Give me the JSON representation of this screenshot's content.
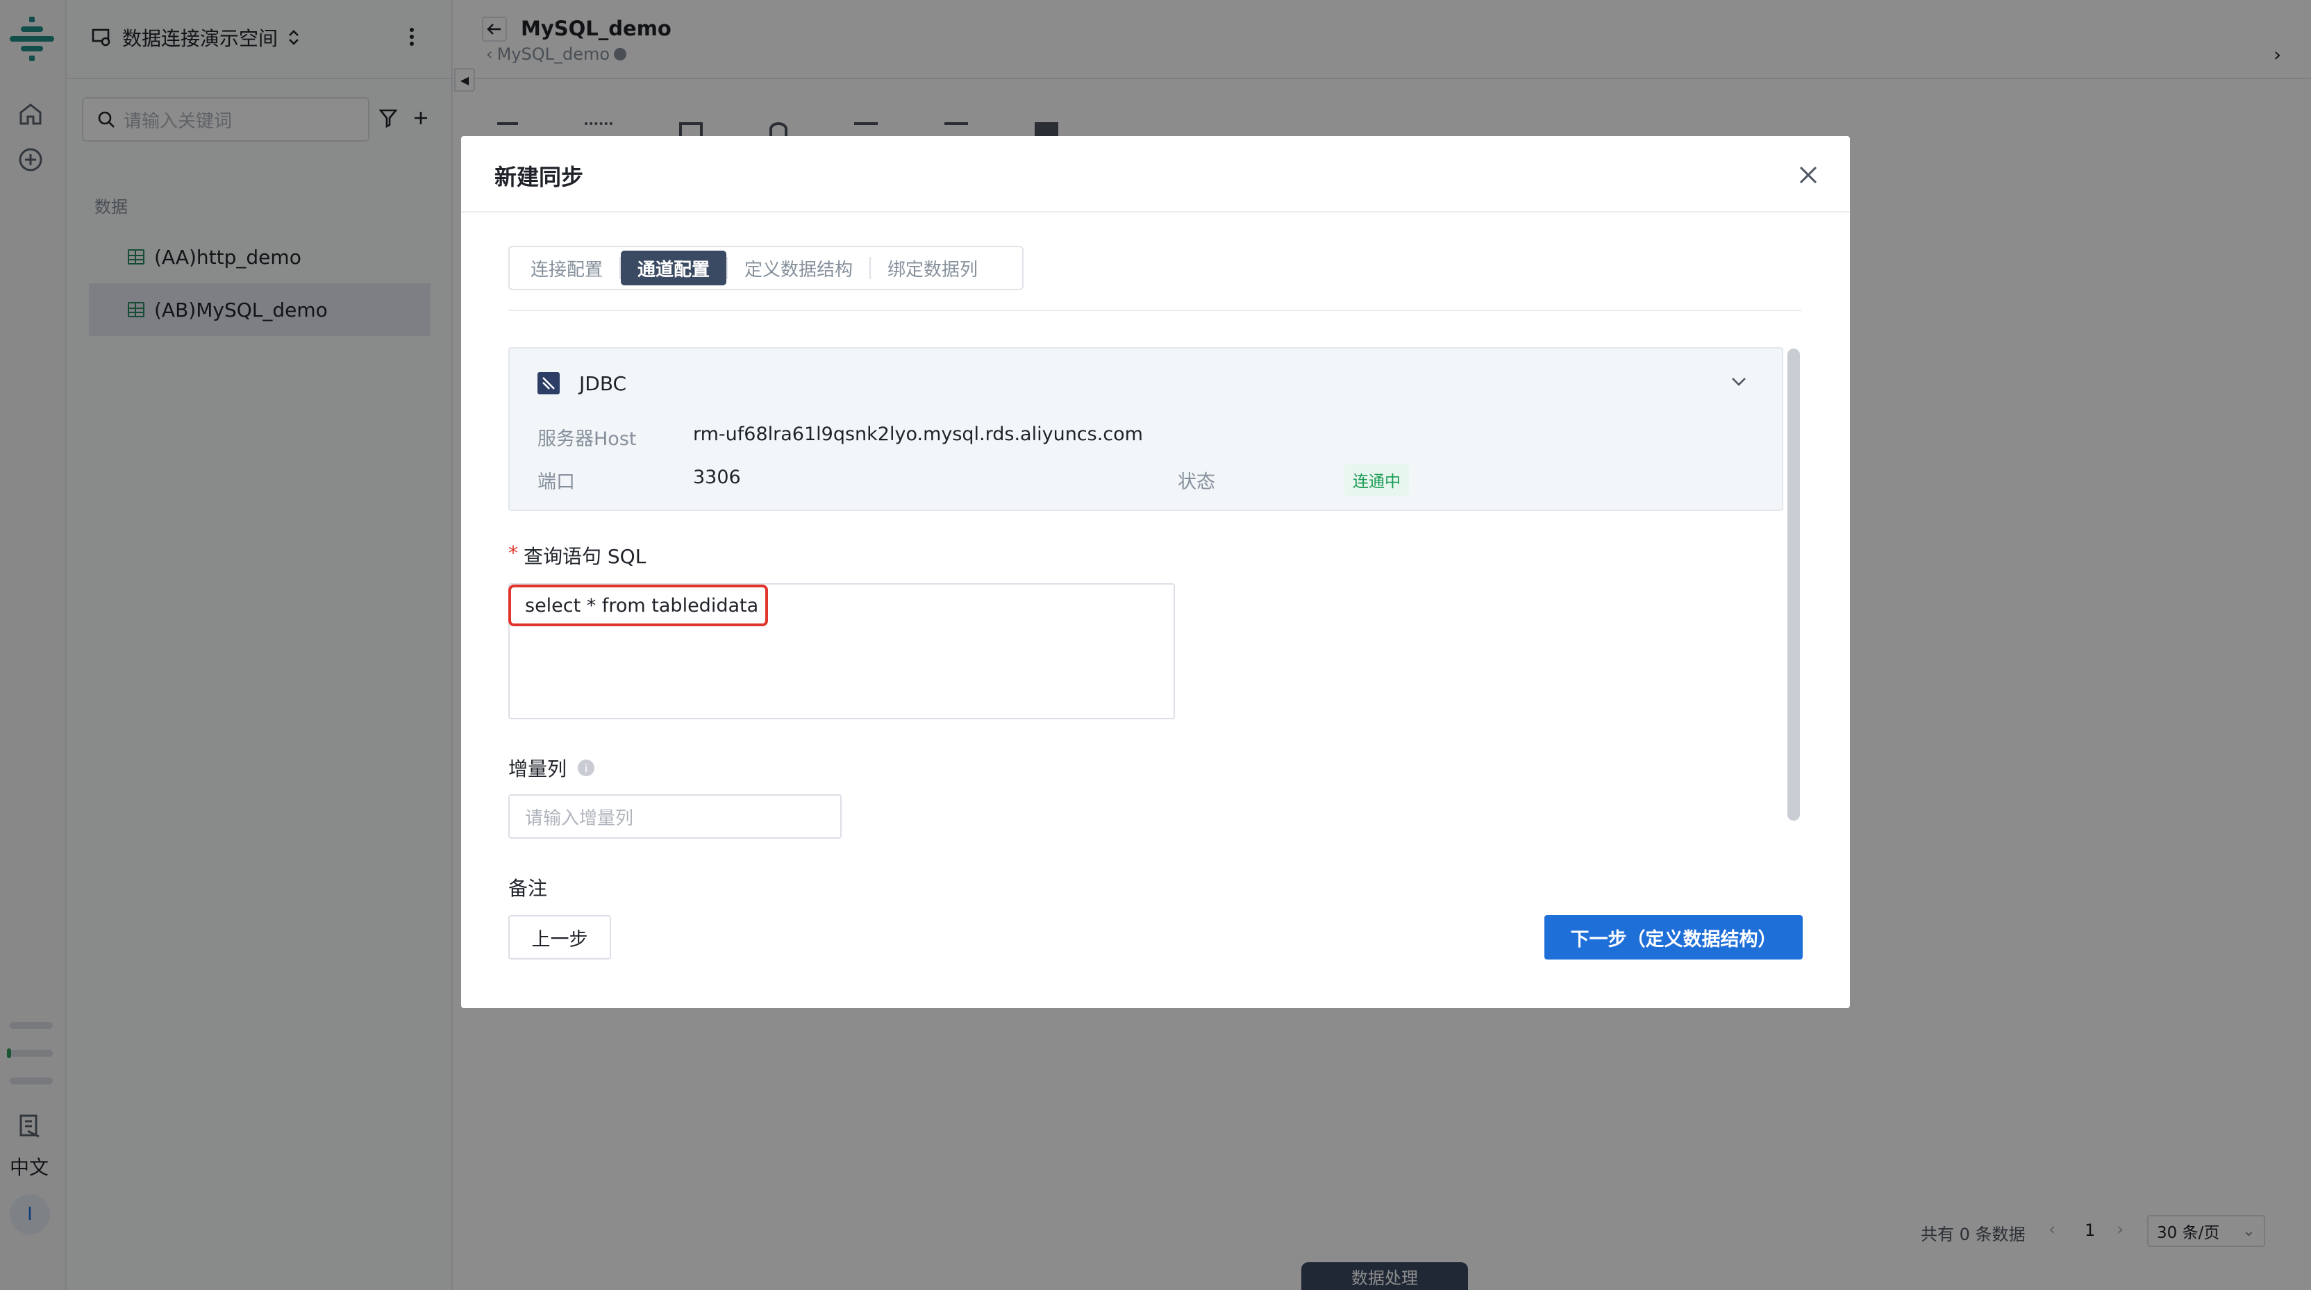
{
  "workspace": {
    "name": "数据连接演示空间"
  },
  "sidebar": {
    "search_placeholder": "请输入关键词",
    "section_label": "数据",
    "items": [
      {
        "label": "(AA)http_demo"
      },
      {
        "label": "(AB)MySQL_demo"
      }
    ]
  },
  "rail": {
    "lang_label": "中文",
    "avatar_letter": "I"
  },
  "header": {
    "title": "MySQL_demo",
    "breadcrumb": "MySQL_demo"
  },
  "footer": {
    "total_text": "共有 0 条数据",
    "page": "1",
    "page_size": "30 条/页",
    "bottom_tab": "数据处理"
  },
  "modal": {
    "title": "新建同步",
    "tabs": [
      {
        "label": "连接配置"
      },
      {
        "label": "通道配置"
      },
      {
        "label": "定义数据结构"
      },
      {
        "label": "绑定数据列"
      }
    ],
    "connector": {
      "type": "JDBC",
      "host_label": "服务器Host",
      "host_value": "rm-uf68lra61l9qsnk2lyo.mysql.rds.aliyuncs.com",
      "port_label": "端口",
      "port_value": "3306",
      "status_label": "状态",
      "status_value": "连通中"
    },
    "sql_label": "查询语句 SQL",
    "sql_required": "*",
    "sql_value": "select * from tabledidata",
    "increment_label": "增量列",
    "increment_placeholder": "请输入增量列",
    "note_label": "备注",
    "prev_button": "上一步",
    "next_button": "下一步（定义数据结构）"
  },
  "colors": {
    "primary": "#1f6fd9",
    "highlight": "#e0352b",
    "status_green": "#1b9b55",
    "active_tab": "#3b4a63"
  }
}
